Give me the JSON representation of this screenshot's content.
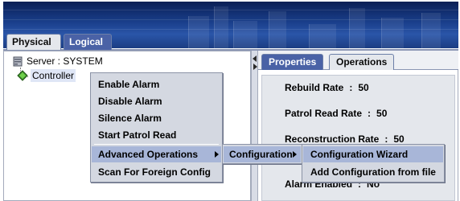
{
  "tabs": {
    "physical": "Physical",
    "logical": "Logical"
  },
  "tree": {
    "server": "Server : SYSTEM",
    "controller": "Controller"
  },
  "right_tabs": {
    "properties": "Properties",
    "operations": "Operations"
  },
  "properties": [
    {
      "name": "Rebuild Rate",
      "value": "50"
    },
    {
      "name": "Patrol Read Rate",
      "value": "50"
    },
    {
      "name": "Reconstruction Rate",
      "value": "50"
    },
    {
      "name": "Alarm Enabled",
      "value": "No"
    }
  ],
  "prop_sep": ":",
  "context_menu": {
    "items": [
      "Enable Alarm",
      "Disable Alarm",
      "Silence Alarm",
      "Start Patrol Read",
      "Advanced Operations",
      "Scan For Foreign Config"
    ]
  },
  "submenu": {
    "label": "Configuration"
  },
  "subsubmenu": {
    "items": [
      "Configuration Wizard",
      "Add Configuration from file"
    ]
  },
  "colors": {
    "banner": "#1a3f8c",
    "highlight": "#a8b6d8",
    "active_tab": "#4a62a6"
  },
  "icons": {
    "server": "server-icon",
    "controller": "controller-icon",
    "submenu": "chevron-right-icon"
  }
}
